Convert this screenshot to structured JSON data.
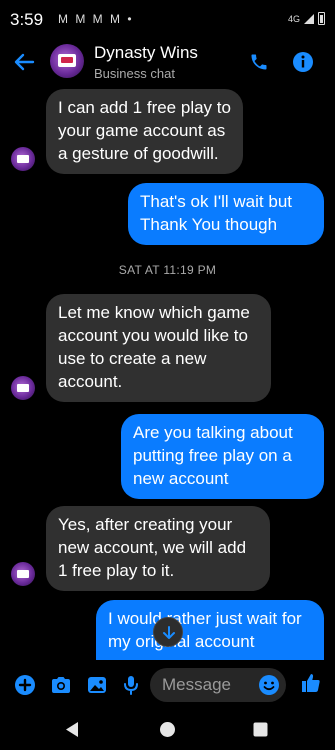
{
  "status_bar": {
    "time": "3:59",
    "notifications": "M M M M •",
    "network": "4G"
  },
  "header": {
    "title": "Dynasty Wins",
    "subtitle": "Business chat"
  },
  "messages": [
    {
      "side": "in",
      "text": "I can add 1 free play to your game account as a gesture of goodwill."
    },
    {
      "side": "out",
      "text": "That's ok I'll wait but Thank You though"
    },
    {
      "side": "in",
      "text": "Let me know which game account you would like to use to create a new account."
    },
    {
      "side": "out",
      "text": "Are you talking about putting free play on a new account"
    },
    {
      "side": "in",
      "text": "Yes, after creating your new account, we will add 1 free play to it."
    },
    {
      "side": "out",
      "text": "I would rather just wait for my original account"
    }
  ],
  "timestamp": "SAT AT 11:19 PM",
  "composer": {
    "placeholder": "Message"
  },
  "colors": {
    "accent": "#0a7cff",
    "incoming_bubble": "#303030",
    "background": "#000000"
  }
}
